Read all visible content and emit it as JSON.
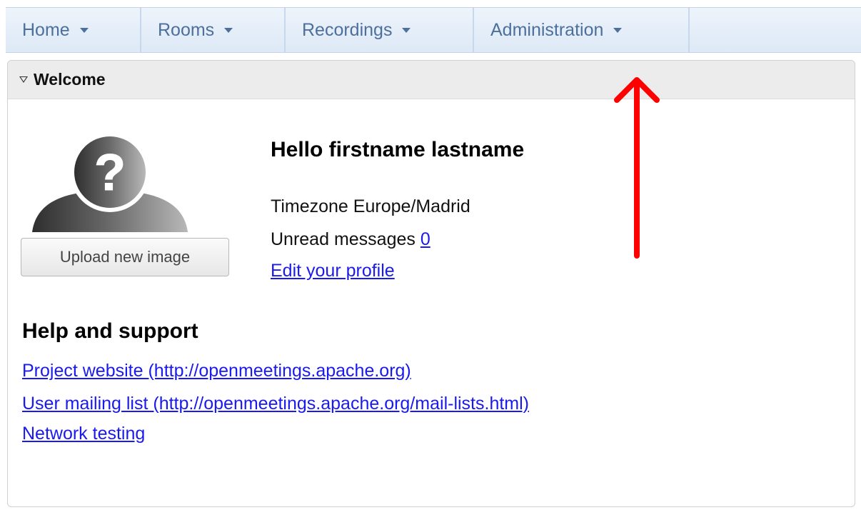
{
  "menu": {
    "items": [
      {
        "label": "Home"
      },
      {
        "label": "Rooms"
      },
      {
        "label": "Recordings"
      },
      {
        "label": "Administration"
      }
    ]
  },
  "welcome": {
    "title": "Welcome",
    "upload_button": "Upload new image",
    "greeting": "Hello firstname lastname",
    "timezone_text": "Timezone Europe/Madrid",
    "unread_label": "Unread messages",
    "unread_count": "0",
    "edit_profile": "Edit your profile"
  },
  "help": {
    "title": "Help and support",
    "links": [
      {
        "label": "Project website (http://openmeetings.apache.org)"
      },
      {
        "label": "User mailing list (http://openmeetings.apache.org/mail-lists.html)"
      },
      {
        "label": "Network testing"
      }
    ]
  },
  "colors": {
    "menu_text": "#4d6f9c",
    "link": "#1a1aee",
    "annotation_arrow": "#ff0000"
  },
  "icons": {
    "avatar": "unknown-user-avatar-icon",
    "panel_toggle": "triangle-down-icon",
    "menu_caret": "caret-down-icon"
  }
}
